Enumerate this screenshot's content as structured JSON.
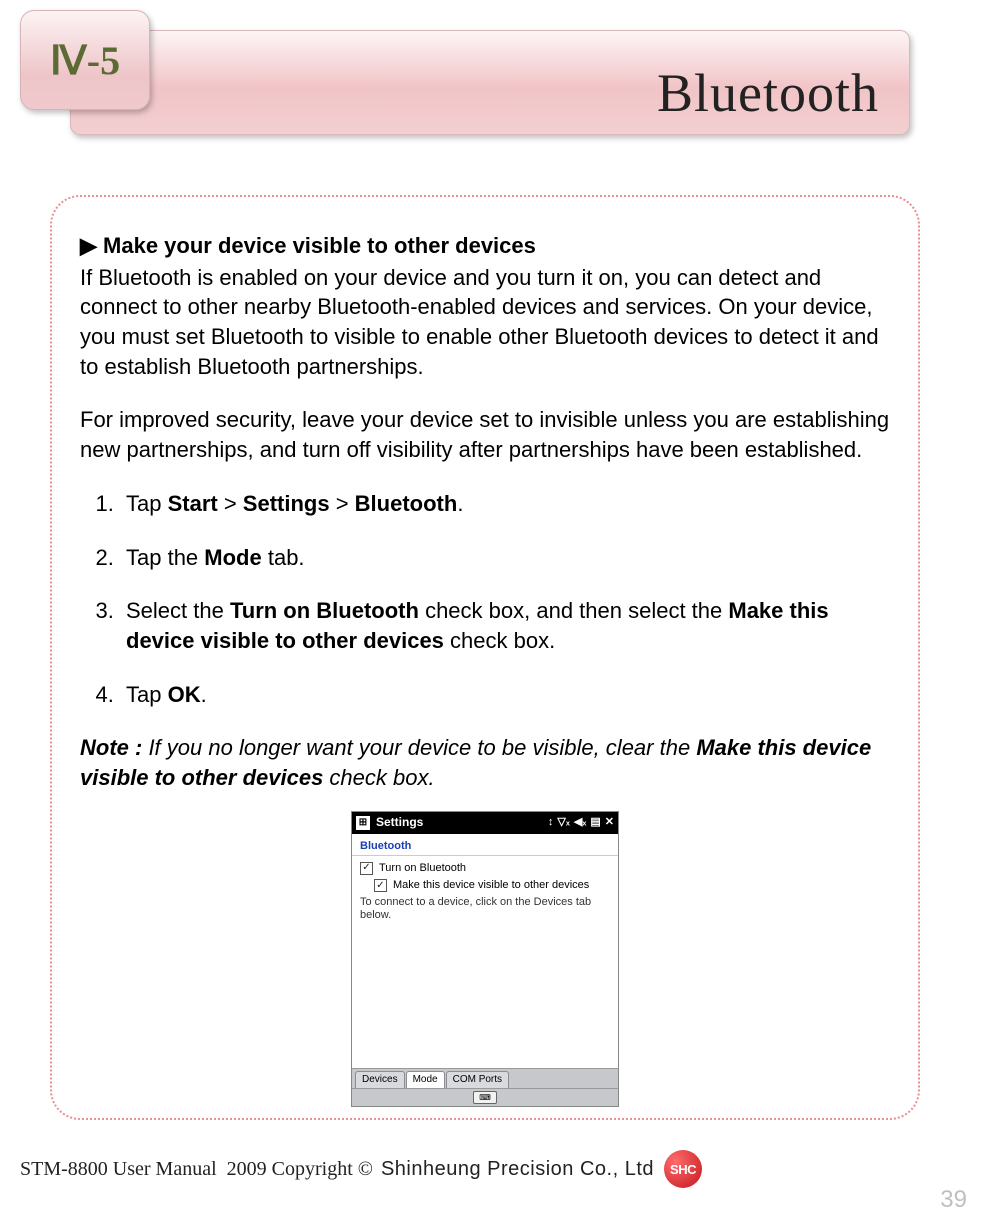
{
  "header": {
    "chapter": "Ⅳ-5",
    "title": "Bluetooth"
  },
  "content": {
    "section_head": "▶ Make your device visible to other devices",
    "intro1": "If Bluetooth is enabled on your device and you turn it on, you can detect and connect to other nearby Bluetooth-enabled devices and services. On your device, you must set Bluetooth to visible to enable other Bluetooth devices to detect it and to establish Bluetooth partnerships.",
    "intro2": "For improved security, leave your device set to invisible unless you are establishing new partnerships, and turn off visibility after partnerships have been established.",
    "steps": {
      "s1_a": "Tap ",
      "s1_b": "Start",
      "s1_c": " > ",
      "s1_d": "Settings",
      "s1_e": " > ",
      "s1_f": "Bluetooth",
      "s1_g": ".",
      "s2_a": "Tap the ",
      "s2_b": "Mode",
      "s2_c": " tab.",
      "s3_a": "Select the ",
      "s3_b": "Turn on Bluetooth",
      "s3_c": " check box, and then select the ",
      "s3_d": "Make this device visible to other devices",
      "s3_e": " check box.",
      "s4_a": "Tap ",
      "s4_b": "OK",
      "s4_c": "."
    },
    "note": {
      "label": "Note :",
      "body_a": " If you no longer want your device to be visible, clear the ",
      "emph": "Make this device visible to other devices",
      "body_b": " check box."
    }
  },
  "screenshot": {
    "titlebar": "Settings",
    "heading": "Bluetooth",
    "cb1": "Turn on Bluetooth",
    "cb2": "Make this device visible to other devices",
    "hint": "To connect to a device, click on the Devices tab below.",
    "tabs": [
      "Devices",
      "Mode",
      "COM Ports"
    ],
    "active_tab_index": 1,
    "status_icons": [
      "↕",
      "▽ₓ",
      "◀ₓ",
      "▤",
      "✕"
    ]
  },
  "footer": {
    "manual": "STM-8800 User Manual",
    "copyright": "2009 Copyright ©",
    "company": "Shinheung Precision Co., Ltd",
    "badge": "SHC",
    "page": "39"
  }
}
